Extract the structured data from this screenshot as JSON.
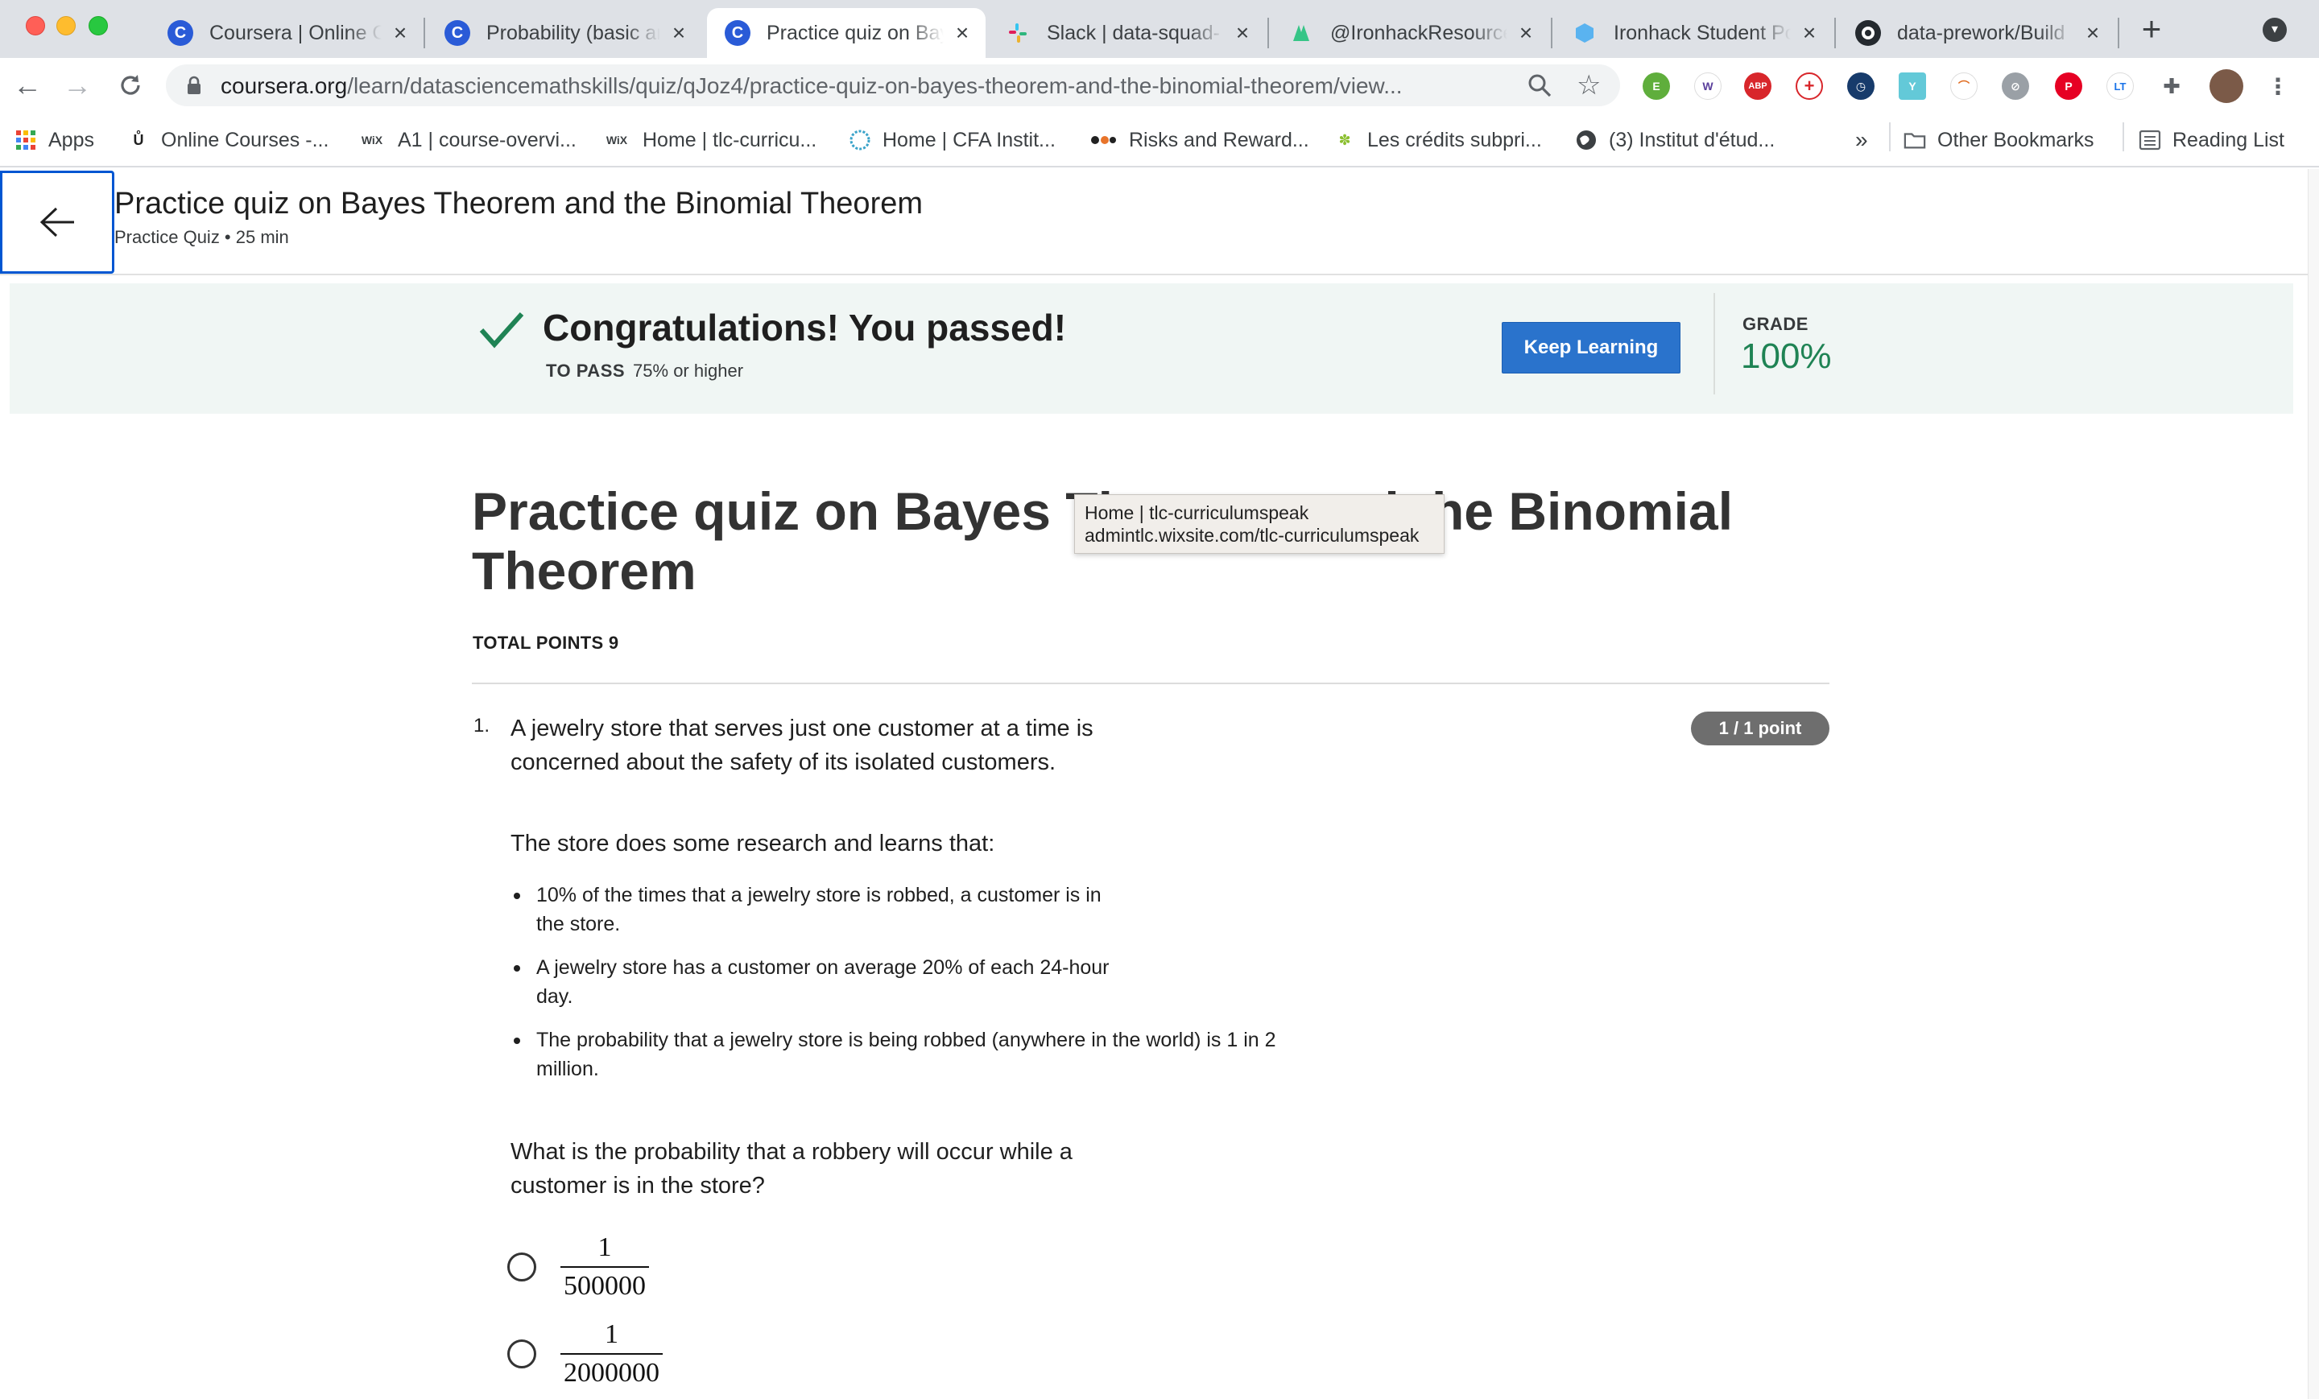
{
  "browser": {
    "tabs": [
      {
        "title": "Coursera | Online Courses & Credentials",
        "icon": "coursera-icon"
      },
      {
        "title": "Probability (basic and conditional)",
        "icon": "coursera-icon"
      },
      {
        "title": "Practice quiz on Bayes Theorem",
        "icon": "coursera-icon",
        "active": true
      },
      {
        "title": "Slack | data-squad-",
        "icon": "slack-icon"
      },
      {
        "title": "@IronhackResources",
        "icon": "ironhack-resources-icon"
      },
      {
        "title": "Ironhack Student Portal",
        "icon": "ironhack-portal-icon"
      },
      {
        "title": "data-prework/Build",
        "icon": "github-icon"
      }
    ],
    "url_domain": "coursera.org",
    "url_path": "/learn/datasciencemathskills/quiz/qJoz4/practice-quiz-on-bayes-theorem-and-the-binomial-theorem/view...",
    "bookmarks": [
      {
        "label": "Apps",
        "icon": "apps-grid-icon"
      },
      {
        "label": "Online Courses -...",
        "icon": "udemy-icon"
      },
      {
        "label": "A1 | course-overvi...",
        "icon": "wix-icon"
      },
      {
        "label": "Home | tlc-curricu...",
        "icon": "wix-icon"
      },
      {
        "label": "Home | CFA Instit...",
        "icon": "cfa-icon"
      },
      {
        "label": "Risks and Reward...",
        "icon": "risks-icon"
      },
      {
        "label": "Les crédits subpri...",
        "icon": "palm-icon"
      },
      {
        "label": "(3) Institut d'étud...",
        "icon": "globe-icon"
      }
    ],
    "bookmarks_overflow": "»",
    "other_bookmarks": "Other Bookmarks",
    "reading_list": "Reading List"
  },
  "header": {
    "title": "Practice quiz on Bayes Theorem and the Binomial Theorem",
    "subtitle": "Practice Quiz • 25 min"
  },
  "banner": {
    "message": "Congratulations! You passed!",
    "to_pass_label": "TO PASS",
    "to_pass_value": "75% or higher",
    "keep_learning": "Keep Learning",
    "grade_label": "GRADE",
    "grade_value": "100%"
  },
  "quiz": {
    "title": "Practice quiz on Bayes Theorem and the Binomial Theorem",
    "total_points": "TOTAL POINTS 9",
    "tooltip_line1": "Home | tlc-curriculumspeak",
    "tooltip_line2": "admintlc.wixsite.com/tlc-curriculumspeak",
    "question": {
      "number": "1.",
      "points": "1 / 1 point",
      "text": "A jewelry store that serves just one customer at a time is concerned about the safety of its isolated customers.",
      "lead": "The store does some research and learns that:",
      "bullets": [
        "10% of the times that a jewelry store is robbed, a customer is in the store.",
        "A jewelry store has a customer on average 20% of each 24-hour day.",
        "The probability that a jewelry store is being robbed (anywhere in the world) is 1 in 2 million."
      ],
      "ask": "What is the probability that a robbery will occur while a customer is in the store?",
      "options": [
        {
          "numerator": "1",
          "denominator": "500000"
        },
        {
          "numerator": "1",
          "denominator": "2000000"
        }
      ]
    }
  },
  "colors": {
    "accent_blue": "#2a73cc",
    "pass_green": "#1f8354",
    "banner_bg": "#f0f6f4"
  }
}
